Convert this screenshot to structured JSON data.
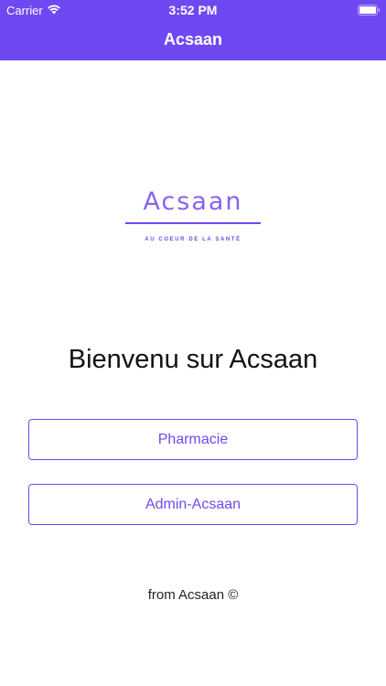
{
  "status_bar": {
    "carrier": "Carrier",
    "time": "3:52 PM",
    "wifi_icon": "wifi-icon",
    "battery_icon": "battery-icon"
  },
  "nav": {
    "title": "Acsaan"
  },
  "logo": {
    "wordmark": "Acsaan",
    "tagline": "AU COEUR DE LA SANTÉ"
  },
  "welcome": {
    "text": "Bienvenu sur Acsaan"
  },
  "buttons": {
    "pharmacie_label": "Pharmacie",
    "admin_label": "Admin-Acsaan"
  },
  "footer": {
    "text": "from Acsaan ©"
  },
  "colors": {
    "accent": "#7048f2",
    "background": "#ffffff"
  }
}
